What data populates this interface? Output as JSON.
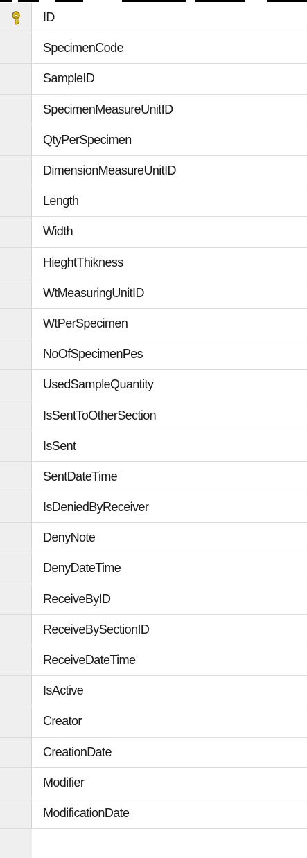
{
  "columns": [
    {
      "name": "ID",
      "primary_key": true,
      "icon": "key-icon"
    },
    {
      "name": "SpecimenCode"
    },
    {
      "name": "SampleID"
    },
    {
      "name": "SpecimenMeasureUnitID"
    },
    {
      "name": "QtyPerSpecimen"
    },
    {
      "name": "DimensionMeasureUnitID"
    },
    {
      "name": "Length"
    },
    {
      "name": "Width"
    },
    {
      "name": "HieghtThikness"
    },
    {
      "name": "WtMeasuringUnitID"
    },
    {
      "name": "WtPerSpecimen"
    },
    {
      "name": "NoOfSpecimenPes"
    },
    {
      "name": "UsedSampleQuantity"
    },
    {
      "name": "IsSentToOtherSection"
    },
    {
      "name": "IsSent"
    },
    {
      "name": "SentDateTime"
    },
    {
      "name": "IsDeniedByReceiver"
    },
    {
      "name": "DenyNote"
    },
    {
      "name": "DenyDateTime"
    },
    {
      "name": "ReceiveByID"
    },
    {
      "name": "ReceiveBySectionID"
    },
    {
      "name": "ReceiveDateTime"
    },
    {
      "name": "IsActive"
    },
    {
      "name": "Creator"
    },
    {
      "name": "CreationDate"
    },
    {
      "name": "Modifier"
    },
    {
      "name": "ModificationDate"
    }
  ],
  "colors": {
    "gutter": "#efefef",
    "row_border": "#dcdcdc",
    "key_gold": "#c9a400",
    "text": "#1a1a1a"
  }
}
